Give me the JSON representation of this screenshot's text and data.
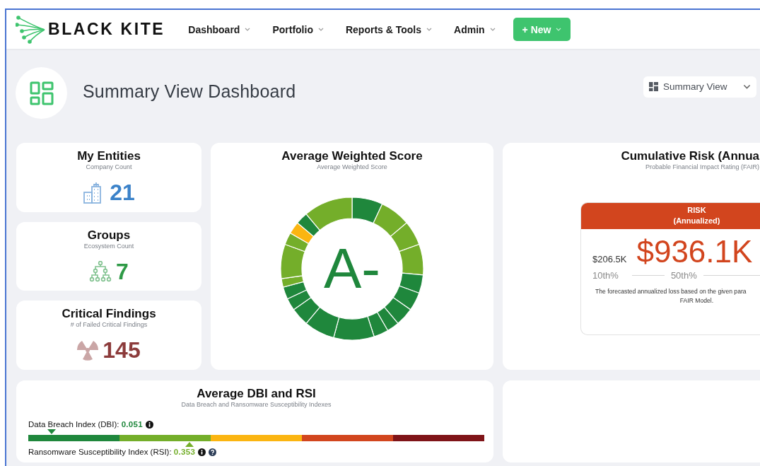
{
  "nav": {
    "brand": "BLACK KITE",
    "items": [
      {
        "label": "Dashboard"
      },
      {
        "label": "Portfolio"
      },
      {
        "label": "Reports & Tools"
      },
      {
        "label": "Admin"
      }
    ],
    "new_button": "+ New"
  },
  "page": {
    "title": "Summary View Dashboard",
    "view_select": "Summary View"
  },
  "stats": [
    {
      "kind": "entities",
      "title": "My Entities",
      "subtitle": "Company Count",
      "value": "21",
      "color": "#3b82c9"
    },
    {
      "kind": "groups",
      "title": "Groups",
      "subtitle": "Ecosystem Count",
      "value": "7",
      "color": "#2e9a46"
    },
    {
      "kind": "findings",
      "title": "Critical Findings",
      "subtitle": "# of Failed Critical Findings",
      "value": "145",
      "color": "#8c3b3b"
    }
  ],
  "score": {
    "title": "Average Weighted Score",
    "subtitle": "Average Weighted Score",
    "grade": "A-"
  },
  "risk": {
    "title": "Cumulative Risk (Annua",
    "subtitle": "Probable Financial Impact Rating (FAIR)",
    "header_lines": [
      "RISK",
      "(Annualized)"
    ],
    "low_value": "$206.5K",
    "low_label": "10th%",
    "median_value": "$936.1K",
    "median_label": "50th%",
    "note_lines": [
      "The forecasted annualized loss based on the given para",
      "FAIR Model."
    ]
  },
  "indexes": {
    "title": "Average DBI and RSI",
    "subtitle": "Data Breach and Ransomware Susceptibility Indexes",
    "scale": [
      {
        "color": "#1f873c"
      },
      {
        "color": "#74ae2a"
      },
      {
        "color": "#fbb511"
      },
      {
        "color": "#d2461e"
      },
      {
        "color": "#7f1418"
      }
    ],
    "items": [
      {
        "kind": "dbi",
        "label": "Data Breach Index (DBI):",
        "value": "0.051",
        "level": 0.051,
        "color": "#1f873c",
        "help": false
      },
      {
        "kind": "rsi",
        "label": "Ransomware Susceptibility Index (RSI):",
        "value": "0.353",
        "level": 0.353,
        "color": "#74ae2a",
        "help": true
      }
    ]
  }
}
